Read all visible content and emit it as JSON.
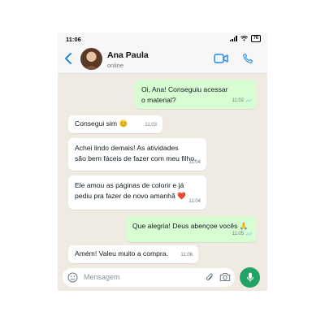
{
  "status_bar": {
    "time": "11:06",
    "battery": "76"
  },
  "header": {
    "contact_name": "Ana Paula",
    "contact_status": "online"
  },
  "messages": [
    {
      "direction": "out",
      "text": "Oi, Ana! Conseguiu acessar\no material?",
      "time": "11:02",
      "read": true
    },
    {
      "direction": "in",
      "text": "Consegui sim 😊",
      "time": "11:03"
    },
    {
      "direction": "in",
      "text": "Achei lindo demais! As atividades\nsão bem fáceis de fazer com meu filho.",
      "time": "11:04"
    },
    {
      "direction": "in",
      "text": "Ele amou as páginas de colorir e já\npediu pra fazer de novo amanhã ❤️",
      "time": "11:04"
    },
    {
      "direction": "out",
      "text": "Que alegria! Deus abençoe vocês 🙏",
      "time": "11:05",
      "read": true
    },
    {
      "direction": "in",
      "text": "Amém! Valeu muito a compra.",
      "time": "11:06"
    }
  ],
  "composer": {
    "placeholder": "Mensagem"
  },
  "colors": {
    "accent": "#21a366",
    "outgoing_bubble": "#d9fdd3",
    "incoming_bubble": "#ffffff",
    "read_ticks": "#53bdeb",
    "header_icons": "#1e88e5"
  }
}
